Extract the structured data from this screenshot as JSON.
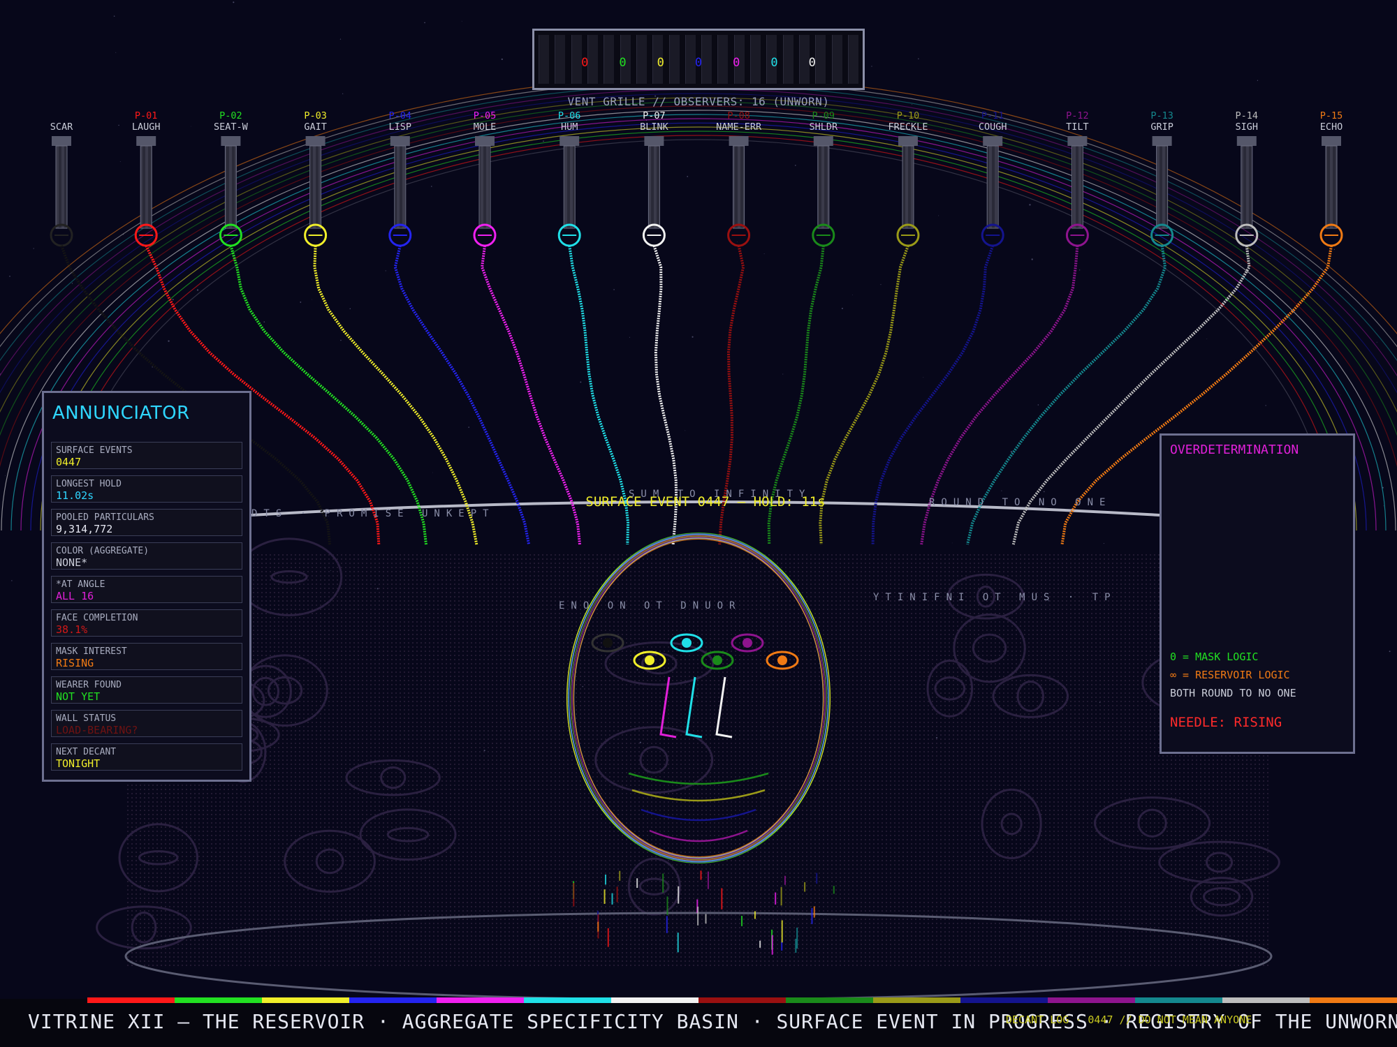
{
  "colors": {
    "background": "#07071a",
    "accent_cyan": "#2fd6ff",
    "accent_yellow": "#f0ee2a",
    "accent_magenta": "#e020d8"
  },
  "grille": {
    "caption": "VENT GRILLE // OBSERVERS: 16 (UNWORN)",
    "glyph": "0"
  },
  "particulars": [
    {
      "id": "",
      "name": "SCAR",
      "color": "#1a1a1a"
    },
    {
      "id": "P-01",
      "name": "LAUGH",
      "color": "#ff1818"
    },
    {
      "id": "P-02",
      "name": "SEAT-W",
      "color": "#22e022"
    },
    {
      "id": "P-03",
      "name": "GAIT",
      "color": "#f0ee2a"
    },
    {
      "id": "P-04",
      "name": "LISP",
      "color": "#2424f0"
    },
    {
      "id": "P-05",
      "name": "MOLE",
      "color": "#f020f0"
    },
    {
      "id": "P-06",
      "name": "HUM",
      "color": "#20e0e8"
    },
    {
      "id": "P-07",
      "name": "BLINK",
      "color": "#f2f2f2"
    },
    {
      "id": "P-08",
      "name": "NAME-ERR",
      "color": "#9a1010"
    },
    {
      "id": "P-09",
      "name": "SHLDR",
      "color": "#1a8a1a"
    },
    {
      "id": "P-10",
      "name": "FRECKLE",
      "color": "#9a9a18"
    },
    {
      "id": "P-11",
      "name": "COUGH",
      "color": "#14148e"
    },
    {
      "id": "P-12",
      "name": "TILT",
      "color": "#8e148e"
    },
    {
      "id": "P-13",
      "name": "GRIP",
      "color": "#14888e"
    },
    {
      "id": "P-14",
      "name": "SIGH",
      "color": "#bdbdbd"
    },
    {
      "id": "P-15",
      "name": "ECHO",
      "color": "#f07a14"
    }
  ],
  "annunciator": {
    "title": "ANNUNCIATOR",
    "rows": [
      {
        "label": "SURFACE EVENTS",
        "value": "0447",
        "color": "#f0ee2a"
      },
      {
        "label": "LONGEST HOLD",
        "value": "11.02s",
        "color": "#2fd6ff"
      },
      {
        "label": "POOLED PARTICULARS",
        "value": "9,314,772",
        "color": "#e6e8f2"
      },
      {
        "label": "COLOR (AGGREGATE)",
        "value": "NONE*",
        "color": "#c9ccd8"
      },
      {
        "label": "*AT ANGLE",
        "value": "ALL 16",
        "color": "#e020d8"
      },
      {
        "label": "FACE COMPLETION",
        "value": "38.1%",
        "color": "#d01818"
      },
      {
        "label": "MASK INTEREST",
        "value": "RISING",
        "color": "#f07a14"
      },
      {
        "label": "WEARER FOUND",
        "value": "NOT YET",
        "color": "#22e022"
      },
      {
        "label": "WALL STATUS",
        "value": "LOAD-BEARING?",
        "color": "#6e1212"
      },
      {
        "label": "NEXT DECANT",
        "value": "TONIGHT",
        "color": "#f0ee2a"
      }
    ]
  },
  "overdetermination": {
    "title": "OVERDETERMINATION",
    "legend": [
      {
        "text": "0 = MASK LOGIC",
        "color": "#22e022"
      },
      {
        "text": "∞ = RESERVOIR LOGIC",
        "color": "#f07a14"
      },
      {
        "text": "BOTH ROUND TO NO ONE",
        "color": "#c9ccd8"
      }
    ],
    "needle_status": "NEEDLE: RISING",
    "needle_level": "rising"
  },
  "surface_event": "SURFACE EVENT 0447 — HOLD: 11s",
  "floating_text": {
    "rim_left": "DTS · PROMISE UNKEPT",
    "rim_mid": "SUM TO INFINITY",
    "rim_right": "ROUND TO NO ONE",
    "inner_left": "ENO ON OT DNUOR",
    "inner_right": "YTINIFNI OT MUS · TP"
  },
  "bottom": {
    "title": "VITRINE XII — THE RESERVOIR · AGGREGATE SPECIFICITY BASIN · SURFACE EVENT IN PROGRESS · REGISTRY OF THE UNWORN",
    "overlay": "DECANT LOG · 0447 // DO NOT MEAN ANYONE"
  }
}
